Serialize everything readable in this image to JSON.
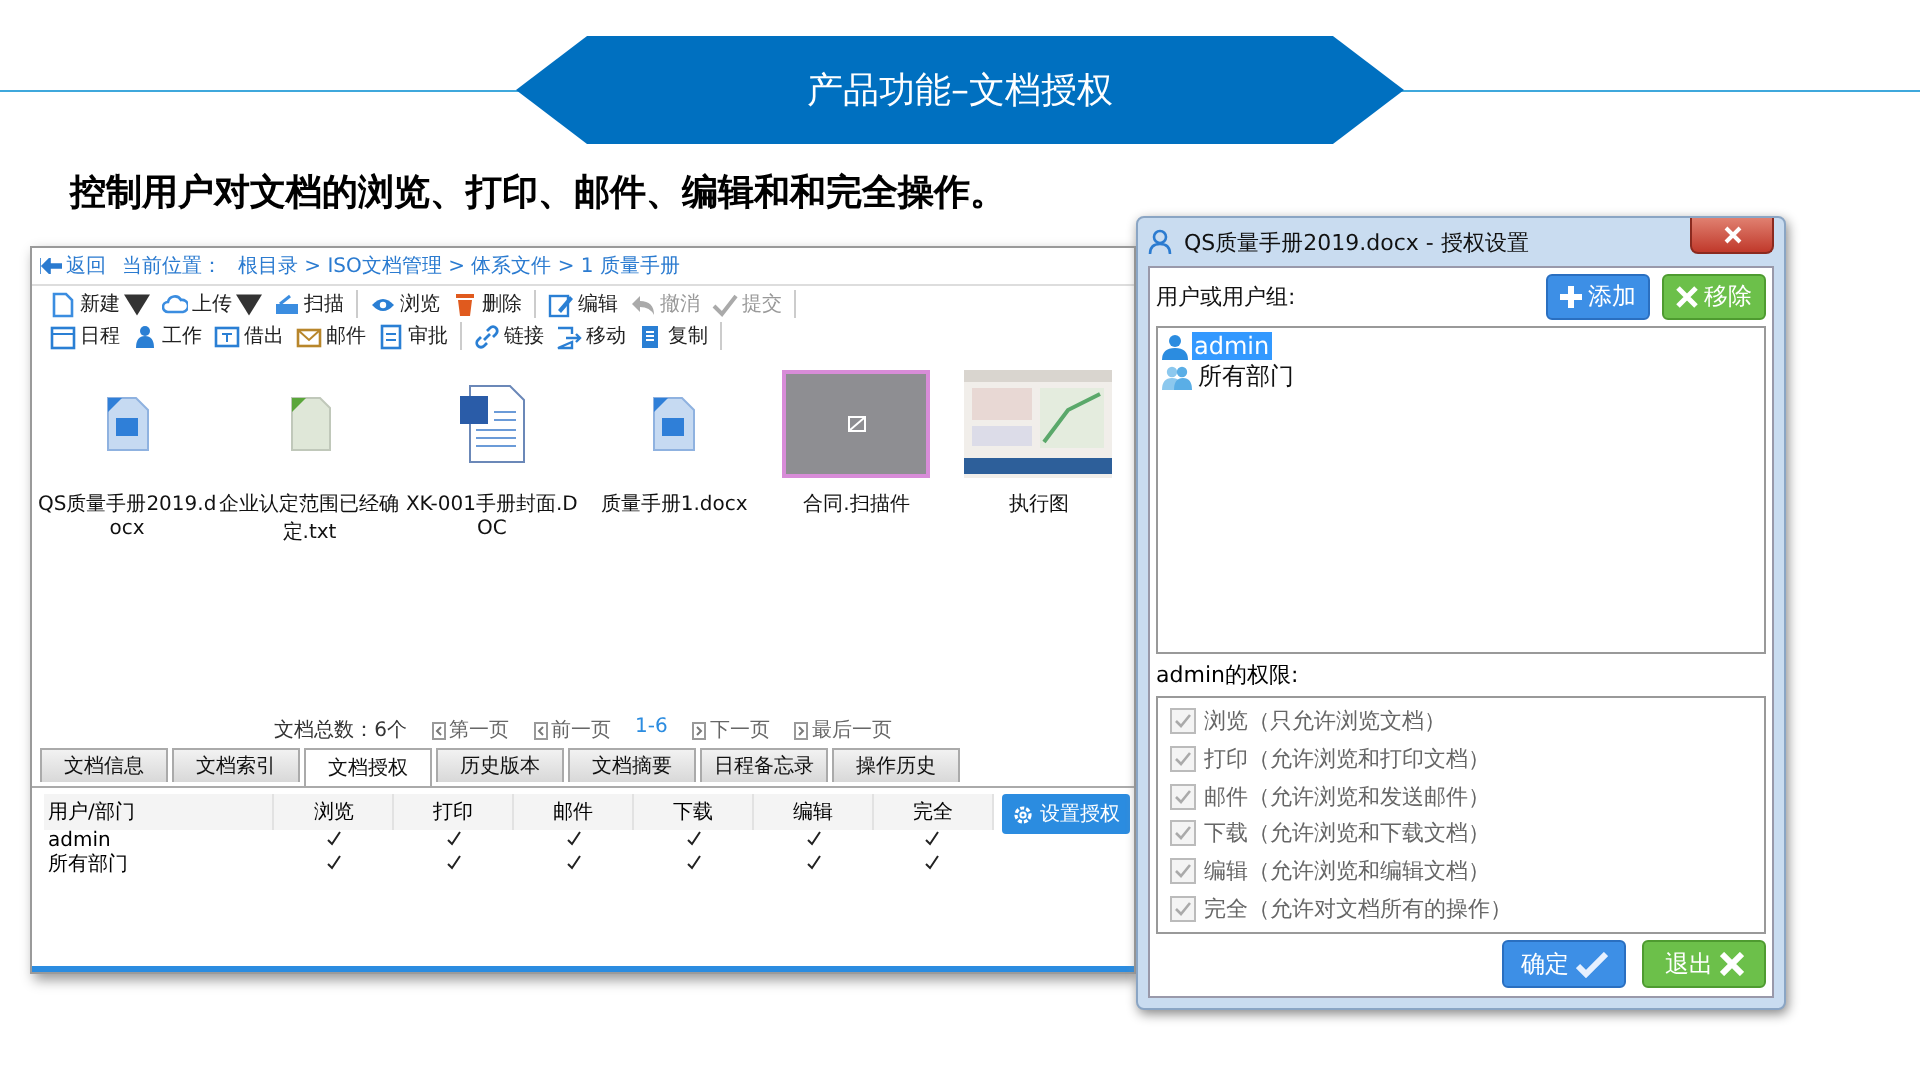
{
  "slide": {
    "title": "产品功能–文档授权",
    "heading": "控制用户对文档的浏览、打印、邮件、编辑和和完全操作。"
  },
  "main_window": {
    "back": "返回",
    "location_label": "当前位置：",
    "breadcrumb": "根目录 > ISO文档管理 > 体系文件 > 1 质量手册",
    "toolbar_groups": [
      {
        "items": [
          {
            "label": "新建",
            "dropdown": true,
            "disabled": false
          },
          {
            "label": "上传",
            "dropdown": true,
            "disabled": false
          },
          {
            "label": "扫描",
            "dropdown": false,
            "disabled": false
          }
        ]
      },
      {
        "items": [
          {
            "label": "浏览",
            "dropdown": false,
            "disabled": false
          },
          {
            "label": "删除",
            "dropdown": false,
            "disabled": false
          }
        ]
      },
      {
        "items": [
          {
            "label": "编辑",
            "dropdown": false,
            "disabled": false
          },
          {
            "label": "撤消",
            "dropdown": false,
            "disabled": true
          },
          {
            "label": "提交",
            "dropdown": false,
            "disabled": true
          }
        ]
      },
      {
        "items": [
          {
            "label": "日程",
            "dropdown": false,
            "disabled": false
          },
          {
            "label": "工作",
            "dropdown": false,
            "disabled": false
          },
          {
            "label": "借出",
            "dropdown": false,
            "disabled": false
          },
          {
            "label": "邮件",
            "dropdown": false,
            "disabled": false
          },
          {
            "label": "审批",
            "dropdown": false,
            "disabled": false
          }
        ]
      },
      {
        "items": [
          {
            "label": "链接",
            "dropdown": false,
            "disabled": false
          },
          {
            "label": "移动",
            "dropdown": false,
            "disabled": false
          },
          {
            "label": "复制",
            "dropdown": false,
            "disabled": false
          }
        ]
      }
    ],
    "files": [
      {
        "name": "QS质量手册2019.docx",
        "kind": "word",
        "selected": false
      },
      {
        "name": "企业认定范围已经确定.txt",
        "kind": "text",
        "selected": false
      },
      {
        "name": "XK-001手册封面.DOC",
        "kind": "word-large",
        "selected": false
      },
      {
        "name": "质量手册1.docx",
        "kind": "word",
        "selected": false
      },
      {
        "name": "合同.扫描件",
        "kind": "placeholder",
        "selected": true
      },
      {
        "name": "执行图",
        "kind": "picture",
        "selected": false
      }
    ],
    "pagination": {
      "total": "文档总数：6个",
      "first": "第一页",
      "prev": "前一页",
      "range": "1-6",
      "next": "下一页",
      "last": "最后一页"
    },
    "tabs": [
      {
        "label": "文档信息",
        "selected": false
      },
      {
        "label": "文档索引",
        "selected": false
      },
      {
        "label": "文档授权",
        "selected": true
      },
      {
        "label": "历史版本",
        "selected": false
      },
      {
        "label": "文档摘要",
        "selected": false
      },
      {
        "label": "日程备忘录",
        "selected": false
      },
      {
        "label": "操作历史",
        "selected": false
      }
    ],
    "permissions_table": {
      "columns": [
        "用户/部门",
        "浏览",
        "打印",
        "邮件",
        "下载",
        "编辑",
        "完全"
      ],
      "rows": [
        {
          "name": "admin",
          "granted": [
            true,
            true,
            true,
            true,
            true,
            true
          ]
        },
        {
          "name": "所有部门",
          "granted": [
            true,
            true,
            true,
            true,
            true,
            true
          ]
        }
      ]
    },
    "set_button": "设置授权"
  },
  "dialog": {
    "title": "QS质量手册2019.docx - 授权设置",
    "users_label": "用户或用户组:",
    "add_button": "添加",
    "remove_button": "移除",
    "users": [
      {
        "name": "admin",
        "kind": "user",
        "selected": true
      },
      {
        "name": "所有部门",
        "kind": "group",
        "selected": false
      }
    ],
    "permissions_label": "admin的权限:",
    "permissions": [
      {
        "label": "浏览（只允许浏览文档）",
        "checked": true,
        "disabled": true
      },
      {
        "label": "打印（允许浏览和打印文档）",
        "checked": true,
        "disabled": true
      },
      {
        "label": "邮件（允许浏览和发送邮件）",
        "checked": true,
        "disabled": true
      },
      {
        "label": "下载（允许浏览和下载文档）",
        "checked": true,
        "disabled": true
      },
      {
        "label": "编辑（允许浏览和编辑文档）",
        "checked": true,
        "disabled": true
      },
      {
        "label": "完全（允许对文档所有的操作）",
        "checked": true,
        "disabled": true
      }
    ],
    "ok_button": "确定",
    "exit_button": "退出"
  }
}
